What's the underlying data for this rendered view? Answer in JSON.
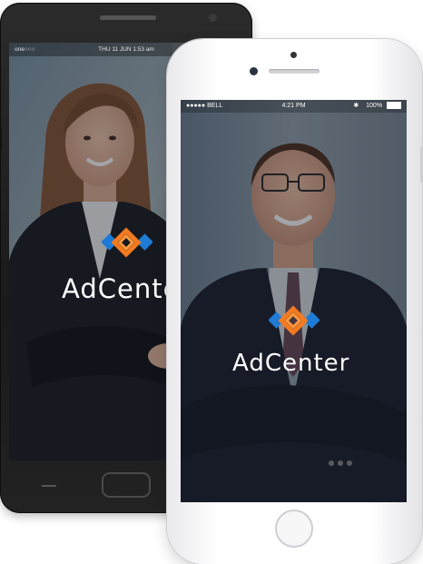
{
  "android": {
    "statusbar": {
      "carrier": "one○○○",
      "datetime": "THU 11 JUN 1:53 am"
    },
    "brand": "AdCenter"
  },
  "iphone": {
    "statusbar": {
      "carrier": "●●●●● BELL",
      "time": "4:21 PM",
      "battery": "100%"
    },
    "brand": "AdCenter"
  },
  "colors": {
    "logo_orange": "#f47a20",
    "logo_blue": "#1e7bd6",
    "android_body": "#1f1f1f",
    "iphone_body": "#ffffff"
  }
}
